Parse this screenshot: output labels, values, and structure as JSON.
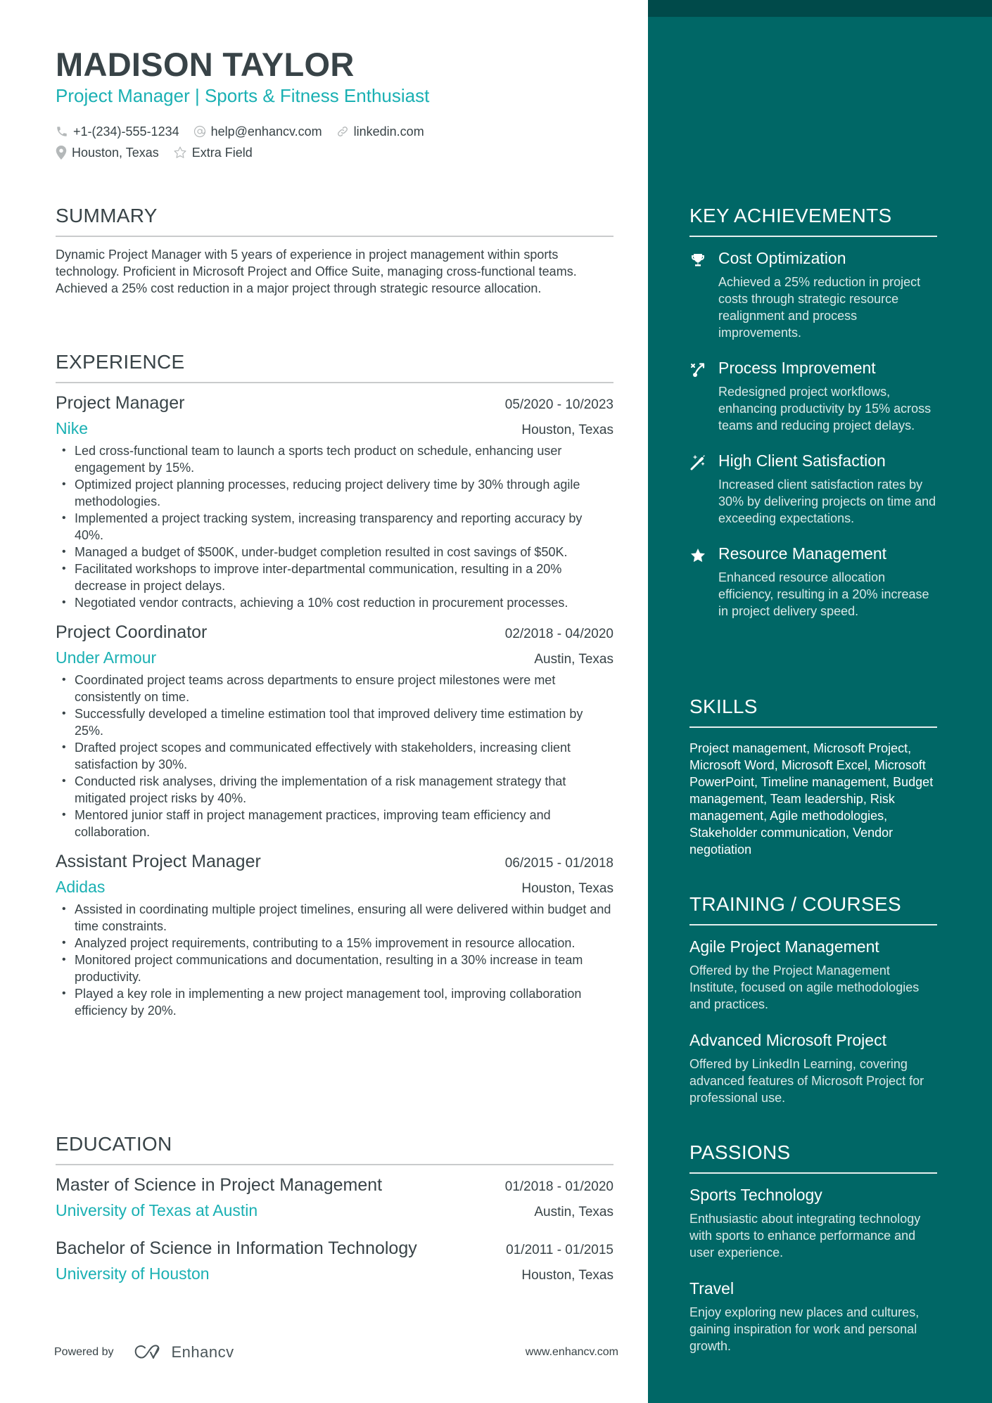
{
  "header": {
    "name": "MADISON TAYLOR",
    "headline": "Project Manager | Sports & Fitness Enthusiast",
    "contacts": {
      "phone": {
        "icon": "phone-icon",
        "value": "+1-(234)-555-1234"
      },
      "email": {
        "icon": "at-icon",
        "value": "help@enhancv.com"
      },
      "link": {
        "icon": "link-icon",
        "value": "linkedin.com"
      },
      "location": {
        "icon": "location-pin-icon",
        "value": "Houston, Texas"
      },
      "extra": {
        "icon": "star-outline-icon",
        "value": "Extra Field"
      }
    }
  },
  "summary": {
    "title": "SUMMARY",
    "text": "Dynamic Project Manager with 5 years of experience in project management within sports technology. Proficient in Microsoft Project and Office Suite, managing cross-functional teams. Achieved a 25% cost reduction in a major project through strategic resource allocation."
  },
  "experience": {
    "title": "EXPERIENCE",
    "jobs": [
      {
        "title": "Project Manager",
        "dates": "05/2020 - 10/2023",
        "company": "Nike",
        "location": "Houston, Texas",
        "bullets": [
          "Led cross-functional team to launch a sports tech product on schedule, enhancing user engagement by 15%.",
          "Optimized project planning processes, reducing project delivery time by 30% through agile methodologies.",
          "Implemented a project tracking system, increasing transparency and reporting accuracy by 40%.",
          "Managed a budget of $500K, under-budget completion resulted in cost savings of $50K.",
          "Facilitated workshops to improve inter-departmental communication, resulting in a 20% decrease in project delays.",
          "Negotiated vendor contracts, achieving a 10% cost reduction in procurement processes."
        ]
      },
      {
        "title": "Project Coordinator",
        "dates": "02/2018 - 04/2020",
        "company": "Under Armour",
        "location": "Austin, Texas",
        "bullets": [
          "Coordinated project teams across departments to ensure project milestones were met consistently on time.",
          "Successfully developed a timeline estimation tool that improved delivery time estimation by 25%.",
          "Drafted project scopes and communicated effectively with stakeholders, increasing client satisfaction by 30%.",
          "Conducted risk analyses, driving the implementation of a risk management strategy that mitigated project risks by 40%.",
          "Mentored junior staff in project management practices, improving team efficiency and collaboration."
        ]
      },
      {
        "title": "Assistant Project Manager",
        "dates": "06/2015 - 01/2018",
        "company": "Adidas",
        "location": "Houston, Texas",
        "bullets": [
          "Assisted in coordinating multiple project timelines, ensuring all were delivered within budget and time constraints.",
          "Analyzed project requirements, contributing to a 15% improvement in resource allocation.",
          "Monitored project communications and documentation, resulting in a 30% increase in team productivity.",
          "Played a key role in implementing a new project management tool, improving collaboration efficiency by 20%."
        ]
      }
    ]
  },
  "education": {
    "title": "EDUCATION",
    "entries": [
      {
        "degree": "Master of Science in Project Management",
        "dates": "01/2018 - 01/2020",
        "school": "University of Texas at Austin",
        "location": "Austin, Texas"
      },
      {
        "degree": "Bachelor of Science in Information Technology",
        "dates": "01/2011 - 01/2015",
        "school": "University of Houston",
        "location": "Houston, Texas"
      }
    ]
  },
  "footer": {
    "powered_by": "Powered by",
    "brand": "Enhancv",
    "website": "www.enhancv.com"
  },
  "sidebar": {
    "achievements": {
      "title": "KEY ACHIEVEMENTS",
      "items": [
        {
          "icon": "trophy-icon",
          "title": "Cost Optimization",
          "desc": "Achieved a 25% reduction in project costs through strategic resource realignment and process improvements."
        },
        {
          "icon": "route-icon",
          "title": "Process Improvement",
          "desc": "Redesigned project workflows, enhancing productivity by 15% across teams and reducing project delays."
        },
        {
          "icon": "magic-wand-icon",
          "title": "High Client Satisfaction",
          "desc": "Increased client satisfaction rates by 30% by delivering projects on time and exceeding expectations."
        },
        {
          "icon": "star-icon",
          "title": "Resource Management",
          "desc": "Enhanced resource allocation efficiency, resulting in a 20% increase in project delivery speed."
        }
      ]
    },
    "skills": {
      "title": "SKILLS",
      "text": "Project management, Microsoft Project, Microsoft Word, Microsoft Excel, Microsoft PowerPoint, Timeline management, Budget management, Team leadership, Risk management, Agile methodologies, Stakeholder communication, Vendor negotiation"
    },
    "training": {
      "title": "TRAINING / COURSES",
      "items": [
        {
          "title": "Agile Project Management",
          "desc": "Offered by the Project Management Institute, focused on agile methodologies and practices."
        },
        {
          "title": "Advanced Microsoft Project",
          "desc": "Offered by LinkedIn Learning, covering advanced features of Microsoft Project for professional use."
        }
      ]
    },
    "passions": {
      "title": "PASSIONS",
      "items": [
        {
          "title": "Sports Technology",
          "desc": "Enthusiastic about integrating technology with sports to enhance performance and user experience."
        },
        {
          "title": "Travel",
          "desc": "Enjoy exploring new places and cultures, gaining inspiration for work and personal growth."
        }
      ]
    }
  },
  "colors": {
    "accent": "#1ab0b3",
    "text": "#384347",
    "sidebar_bg": "#006766",
    "sidebar_top": "#004a4a"
  }
}
